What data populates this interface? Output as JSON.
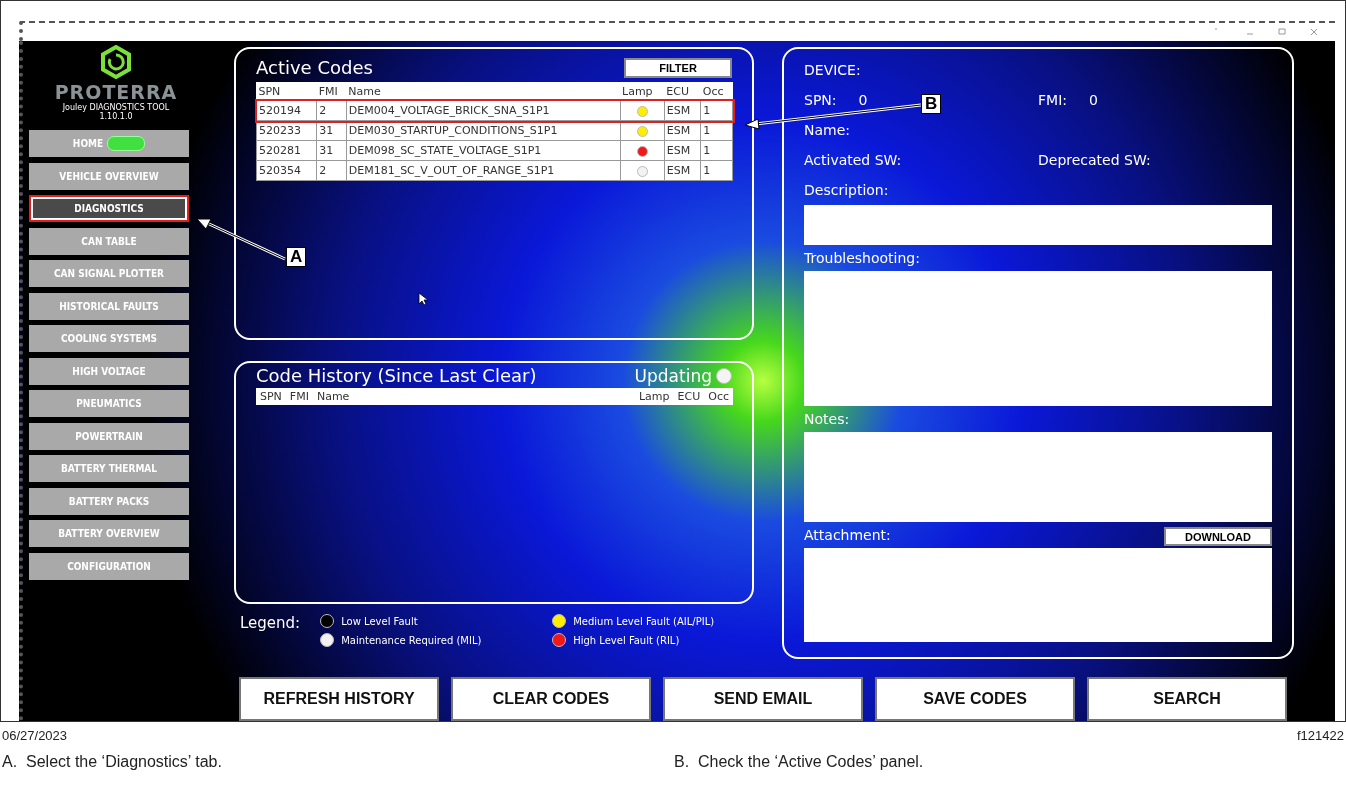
{
  "sidebar": {
    "brand": "PROTERRA",
    "tool": "Jouley DIAGNOSTICS TOOL",
    "version": "1.10.1.0",
    "items": [
      {
        "label": "HOME",
        "selected": false,
        "toggle": true
      },
      {
        "label": "VEHICLE OVERVIEW",
        "selected": false,
        "toggle": false
      },
      {
        "label": "DIAGNOSTICS",
        "selected": true,
        "toggle": false
      },
      {
        "label": "CAN TABLE",
        "selected": false,
        "toggle": false
      },
      {
        "label": "CAN SIGNAL PLOTTER",
        "selected": false,
        "toggle": false
      },
      {
        "label": "HISTORICAL FAULTS",
        "selected": false,
        "toggle": false
      },
      {
        "label": "COOLING SYSTEMS",
        "selected": false,
        "toggle": false
      },
      {
        "label": "HIGH VOLTAGE",
        "selected": false,
        "toggle": false
      },
      {
        "label": "PNEUMATICS",
        "selected": false,
        "toggle": false
      },
      {
        "label": "POWERTRAIN",
        "selected": false,
        "toggle": false
      },
      {
        "label": "BATTERY THERMAL",
        "selected": false,
        "toggle": false
      },
      {
        "label": "BATTERY PACKS",
        "selected": false,
        "toggle": false
      },
      {
        "label": "BATTERY OVERVIEW",
        "selected": false,
        "toggle": false
      },
      {
        "label": "CONFIGURATION",
        "selected": false,
        "toggle": false
      }
    ]
  },
  "active_codes": {
    "title": "Active Codes",
    "filter": "FILTER",
    "columns": [
      "SPN",
      "FMI",
      "Name",
      "Lamp",
      "ECU",
      "Occ"
    ],
    "rows": [
      {
        "spn": "520194",
        "fmi": "2",
        "name": "DEM004_VOLTAGE_BRICK_SNA_S1P1",
        "color": "#ffee00",
        "ecu": "ESM",
        "occ": "1",
        "highlighted": true
      },
      {
        "spn": "520233",
        "fmi": "31",
        "name": "DEM030_STARTUP_CONDITIONS_S1P1",
        "color": "#ffee00",
        "ecu": "ESM",
        "occ": "1",
        "highlighted": false
      },
      {
        "spn": "520281",
        "fmi": "31",
        "name": "DEM098_SC_STATE_VOLTAGE_S1P1",
        "color": "#f01818",
        "ecu": "ESM",
        "occ": "1",
        "highlighted": false
      },
      {
        "spn": "520354",
        "fmi": "2",
        "name": "DEM181_SC_V_OUT_OF_RANGE_S1P1",
        "color": "#f2f2f2",
        "ecu": "ESM",
        "occ": "1",
        "highlighted": false
      }
    ]
  },
  "code_history": {
    "title": "Code History (Since Last Clear)",
    "status": "Updating",
    "columns": [
      "SPN",
      "FMI",
      "Name",
      "Lamp",
      "ECU",
      "Occ"
    ]
  },
  "legend": {
    "label": "Legend:",
    "items": [
      {
        "color": "#000000",
        "text": "Low Level Fault"
      },
      {
        "color": "#ffee00",
        "text": "Medium Level Fault (AIL/PIL)"
      },
      {
        "color": "#f2f2f2",
        "text": "Maintenance Required (MIL)"
      },
      {
        "color": "#f01818",
        "text": "High Level Fault (RIL)"
      }
    ]
  },
  "details": {
    "device": "DEVICE:",
    "spn_label": "SPN:",
    "spn": "0",
    "fmi_label": "FMI:",
    "fmi": "0",
    "name": "Name:",
    "activated": "Activated SW:",
    "deprecated": "Deprecated SW:",
    "description": "Description:",
    "troubleshooting": "Troubleshooting:",
    "notes": "Notes:",
    "attachment": "Attachment:",
    "download": "DOWNLOAD"
  },
  "buttons": [
    "REFRESH HISTORY",
    "CLEAR CODES",
    "SEND EMAIL",
    "SAVE CODES",
    "SEARCH"
  ],
  "callouts": [
    {
      "letter": "A",
      "caption": "A.  Select the ‘Diagnostics’ tab."
    },
    {
      "letter": "B",
      "caption": "B.  Check the ‘Active Codes’ panel."
    }
  ],
  "footer": {
    "date": "06/27/2023",
    "figure": "f121422"
  }
}
